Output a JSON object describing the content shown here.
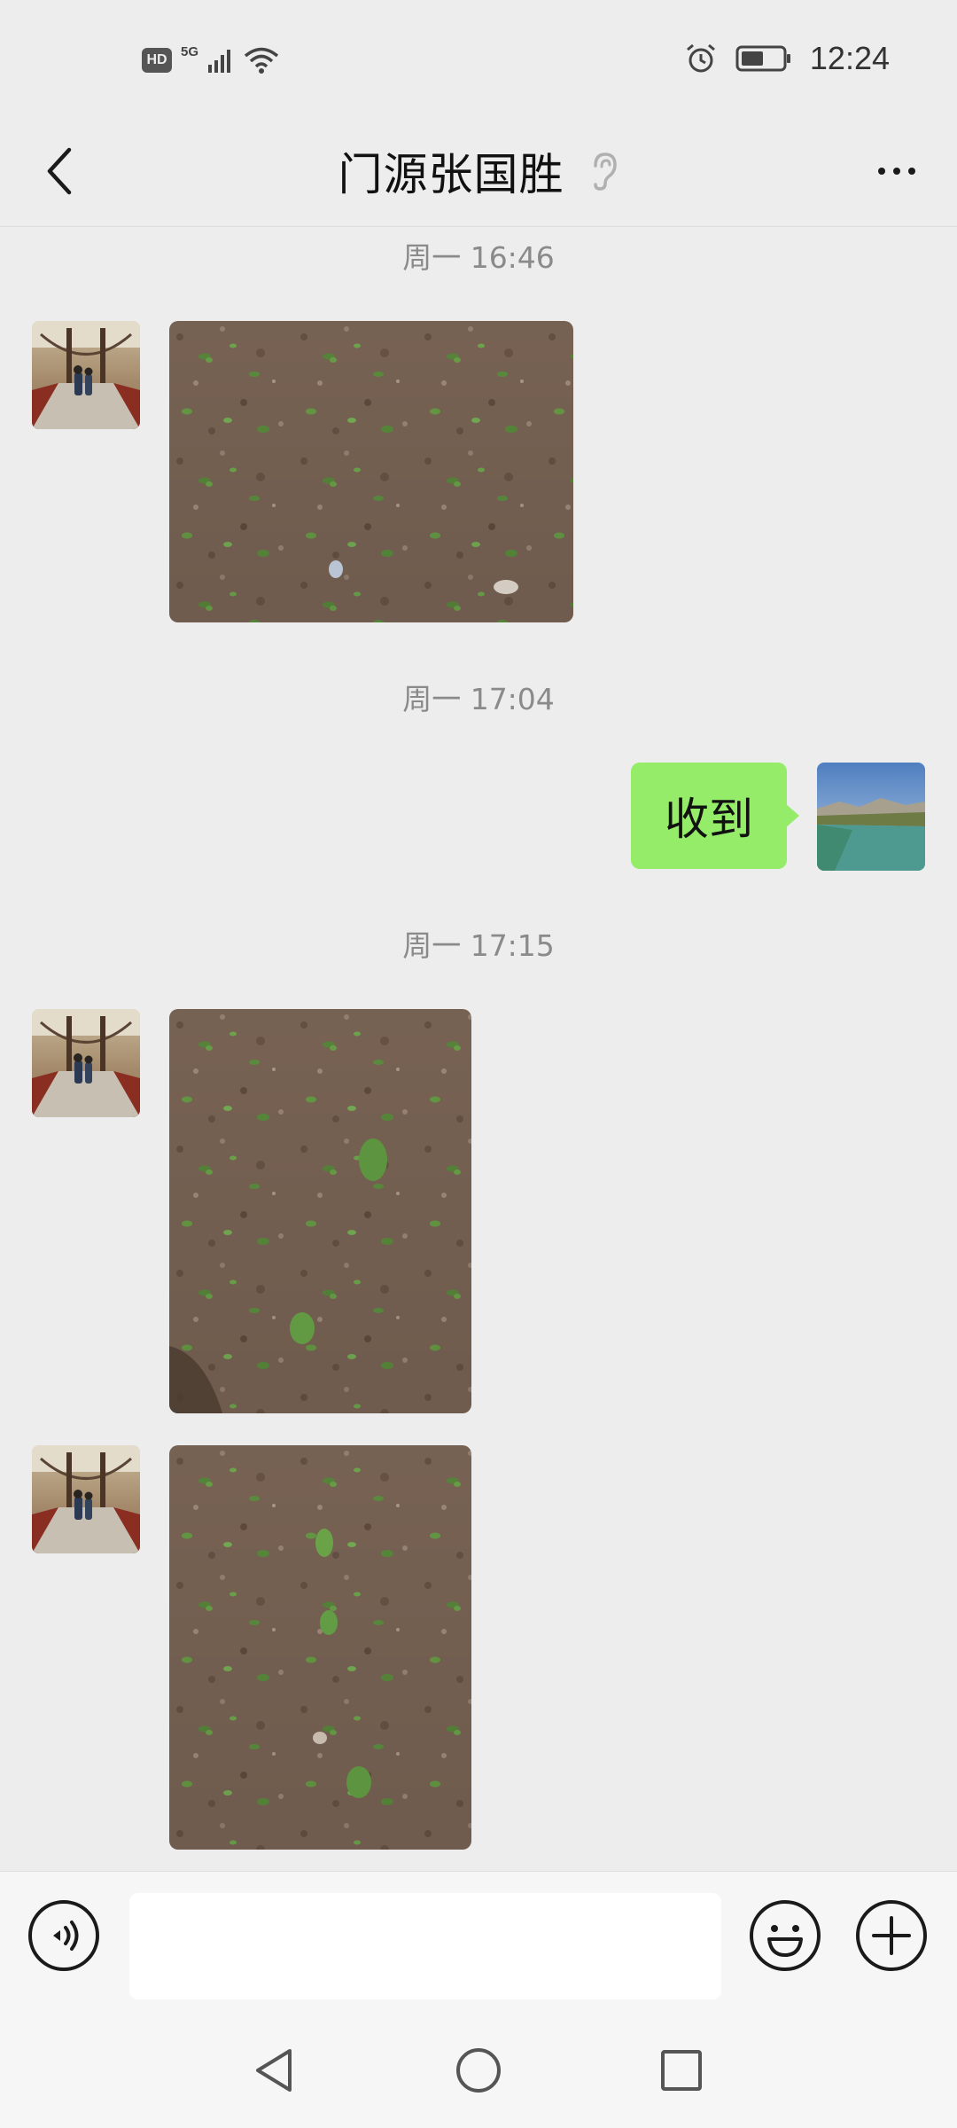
{
  "status_bar": {
    "hd_badge": "HD",
    "network_label": "5G",
    "time": "12:24",
    "icons": [
      "hd-icon",
      "signal-icon",
      "wifi-icon",
      "alarm-icon",
      "battery-icon"
    ]
  },
  "header": {
    "title": "门源张国胜",
    "icons": [
      "back-chevron-icon",
      "ear-icon",
      "more-dots-icon"
    ]
  },
  "messages": [
    {
      "type": "timestamp",
      "text": "周一 16:46"
    },
    {
      "type": "image",
      "sender": "contact",
      "avatar": "bridge-avatar",
      "content": "soil-field-photo"
    },
    {
      "type": "timestamp",
      "text": "周一 17:04"
    },
    {
      "type": "text",
      "sender": "self",
      "avatar": "lake-avatar",
      "text": "收到"
    },
    {
      "type": "timestamp",
      "text": "周一 17:15"
    },
    {
      "type": "image",
      "sender": "contact",
      "avatar": "bridge-avatar",
      "content": "soil-field-photo"
    },
    {
      "type": "image",
      "sender": "contact",
      "avatar": "bridge-avatar",
      "content": "soil-field-photo"
    }
  ],
  "input_bar": {
    "value": "",
    "placeholder": "",
    "icons": [
      "voice-icon",
      "emoji-icon",
      "plus-icon"
    ]
  },
  "nav_bar": {
    "icons": [
      "nav-back-icon",
      "nav-home-icon",
      "nav-recents-icon"
    ]
  },
  "colors": {
    "background": "#ededed",
    "sent_bubble": "#95ec69",
    "timestamp_text": "#8a8a8a",
    "input_bar_bg": "#f6f6f6"
  }
}
